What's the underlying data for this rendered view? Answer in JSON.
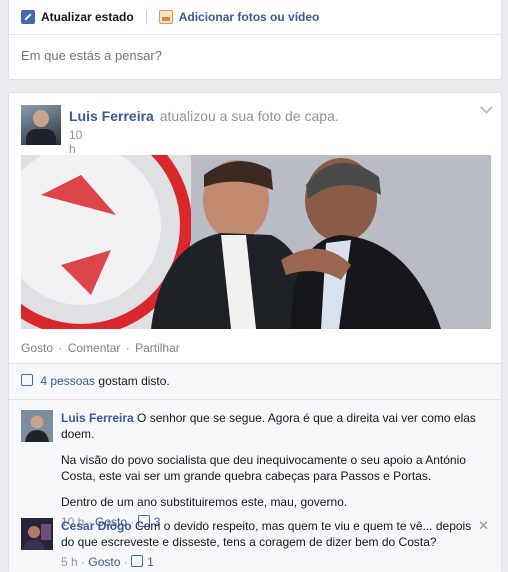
{
  "composer": {
    "tab_status": "Atualizar estado",
    "tab_photos": "Adicionar fotos ou vídeo",
    "placeholder": "Em que estás a pensar?"
  },
  "post": {
    "author": "Luis Ferreira",
    "action": "atualizou a sua foto de capa.",
    "time": "10 h ·",
    "actions": [
      "Gosto",
      "Comentar",
      "Partilhar"
    ],
    "likes_count": "4 pessoas",
    "likes_suffix": "gostam disto."
  },
  "comments": [
    {
      "author": "Luis Ferreira",
      "paragraphs": [
        "O senhor que se segue. Agora é que a direita vai ver como elas doem.",
        "Na visão do povo socialista que deu inequivocamente o seu apoio a António Costa, este vai ser um grande quebra cabeças para Passos e Portas.",
        "Dentro de um ano substituiremos este, mau, governo."
      ],
      "time": "10 h ·",
      "like_label": "Gosto",
      "like_count": ""
    },
    {
      "author": "Cesar Diogo",
      "paragraphs": [
        "Com o devido respeito, mas quem te viu e quem te vê... depois do que escreveste e disseste, tens a coragem de dizer bem do Costa?"
      ],
      "time": "5 h ·",
      "like_label": "Gosto",
      "like_count": "1"
    }
  ],
  "misc": {
    "comment0_likes_after": "3",
    "close_glyph": "✕"
  },
  "colors": {
    "link": "#3b5998",
    "muted": "#90949c",
    "background": "#e9ebee"
  }
}
